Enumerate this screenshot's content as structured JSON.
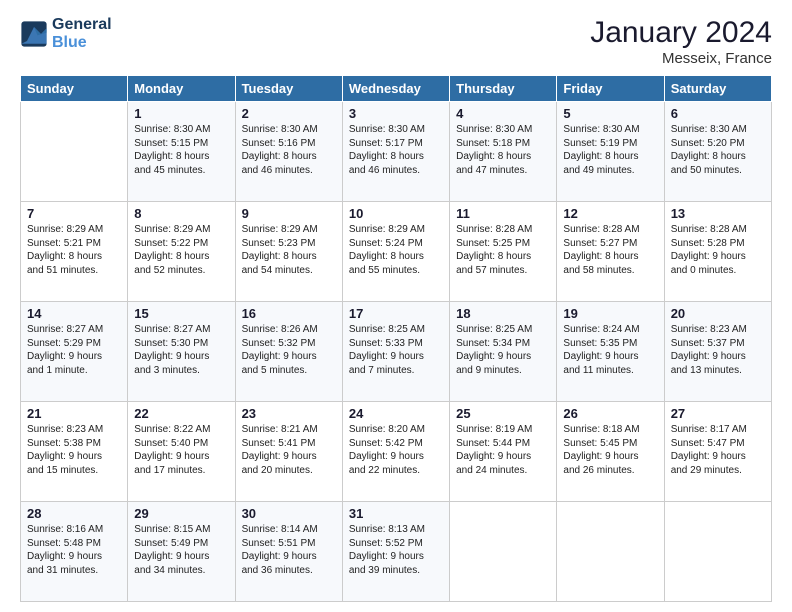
{
  "header": {
    "logo_line1": "General",
    "logo_line2": "Blue",
    "month": "January 2024",
    "location": "Messeix, France"
  },
  "weekdays": [
    "Sunday",
    "Monday",
    "Tuesday",
    "Wednesday",
    "Thursday",
    "Friday",
    "Saturday"
  ],
  "weeks": [
    [
      {
        "day": "",
        "sunrise": "",
        "sunset": "",
        "daylight": ""
      },
      {
        "day": "1",
        "sunrise": "Sunrise: 8:30 AM",
        "sunset": "Sunset: 5:15 PM",
        "daylight": "Daylight: 8 hours and 45 minutes."
      },
      {
        "day": "2",
        "sunrise": "Sunrise: 8:30 AM",
        "sunset": "Sunset: 5:16 PM",
        "daylight": "Daylight: 8 hours and 46 minutes."
      },
      {
        "day": "3",
        "sunrise": "Sunrise: 8:30 AM",
        "sunset": "Sunset: 5:17 PM",
        "daylight": "Daylight: 8 hours and 46 minutes."
      },
      {
        "day": "4",
        "sunrise": "Sunrise: 8:30 AM",
        "sunset": "Sunset: 5:18 PM",
        "daylight": "Daylight: 8 hours and 47 minutes."
      },
      {
        "day": "5",
        "sunrise": "Sunrise: 8:30 AM",
        "sunset": "Sunset: 5:19 PM",
        "daylight": "Daylight: 8 hours and 49 minutes."
      },
      {
        "day": "6",
        "sunrise": "Sunrise: 8:30 AM",
        "sunset": "Sunset: 5:20 PM",
        "daylight": "Daylight: 8 hours and 50 minutes."
      }
    ],
    [
      {
        "day": "7",
        "sunrise": "Sunrise: 8:29 AM",
        "sunset": "Sunset: 5:21 PM",
        "daylight": "Daylight: 8 hours and 51 minutes."
      },
      {
        "day": "8",
        "sunrise": "Sunrise: 8:29 AM",
        "sunset": "Sunset: 5:22 PM",
        "daylight": "Daylight: 8 hours and 52 minutes."
      },
      {
        "day": "9",
        "sunrise": "Sunrise: 8:29 AM",
        "sunset": "Sunset: 5:23 PM",
        "daylight": "Daylight: 8 hours and 54 minutes."
      },
      {
        "day": "10",
        "sunrise": "Sunrise: 8:29 AM",
        "sunset": "Sunset: 5:24 PM",
        "daylight": "Daylight: 8 hours and 55 minutes."
      },
      {
        "day": "11",
        "sunrise": "Sunrise: 8:28 AM",
        "sunset": "Sunset: 5:25 PM",
        "daylight": "Daylight: 8 hours and 57 minutes."
      },
      {
        "day": "12",
        "sunrise": "Sunrise: 8:28 AM",
        "sunset": "Sunset: 5:27 PM",
        "daylight": "Daylight: 8 hours and 58 minutes."
      },
      {
        "day": "13",
        "sunrise": "Sunrise: 8:28 AM",
        "sunset": "Sunset: 5:28 PM",
        "daylight": "Daylight: 9 hours and 0 minutes."
      }
    ],
    [
      {
        "day": "14",
        "sunrise": "Sunrise: 8:27 AM",
        "sunset": "Sunset: 5:29 PM",
        "daylight": "Daylight: 9 hours and 1 minute."
      },
      {
        "day": "15",
        "sunrise": "Sunrise: 8:27 AM",
        "sunset": "Sunset: 5:30 PM",
        "daylight": "Daylight: 9 hours and 3 minutes."
      },
      {
        "day": "16",
        "sunrise": "Sunrise: 8:26 AM",
        "sunset": "Sunset: 5:32 PM",
        "daylight": "Daylight: 9 hours and 5 minutes."
      },
      {
        "day": "17",
        "sunrise": "Sunrise: 8:25 AM",
        "sunset": "Sunset: 5:33 PM",
        "daylight": "Daylight: 9 hours and 7 minutes."
      },
      {
        "day": "18",
        "sunrise": "Sunrise: 8:25 AM",
        "sunset": "Sunset: 5:34 PM",
        "daylight": "Daylight: 9 hours and 9 minutes."
      },
      {
        "day": "19",
        "sunrise": "Sunrise: 8:24 AM",
        "sunset": "Sunset: 5:35 PM",
        "daylight": "Daylight: 9 hours and 11 minutes."
      },
      {
        "day": "20",
        "sunrise": "Sunrise: 8:23 AM",
        "sunset": "Sunset: 5:37 PM",
        "daylight": "Daylight: 9 hours and 13 minutes."
      }
    ],
    [
      {
        "day": "21",
        "sunrise": "Sunrise: 8:23 AM",
        "sunset": "Sunset: 5:38 PM",
        "daylight": "Daylight: 9 hours and 15 minutes."
      },
      {
        "day": "22",
        "sunrise": "Sunrise: 8:22 AM",
        "sunset": "Sunset: 5:40 PM",
        "daylight": "Daylight: 9 hours and 17 minutes."
      },
      {
        "day": "23",
        "sunrise": "Sunrise: 8:21 AM",
        "sunset": "Sunset: 5:41 PM",
        "daylight": "Daylight: 9 hours and 20 minutes."
      },
      {
        "day": "24",
        "sunrise": "Sunrise: 8:20 AM",
        "sunset": "Sunset: 5:42 PM",
        "daylight": "Daylight: 9 hours and 22 minutes."
      },
      {
        "day": "25",
        "sunrise": "Sunrise: 8:19 AM",
        "sunset": "Sunset: 5:44 PM",
        "daylight": "Daylight: 9 hours and 24 minutes."
      },
      {
        "day": "26",
        "sunrise": "Sunrise: 8:18 AM",
        "sunset": "Sunset: 5:45 PM",
        "daylight": "Daylight: 9 hours and 26 minutes."
      },
      {
        "day": "27",
        "sunrise": "Sunrise: 8:17 AM",
        "sunset": "Sunset: 5:47 PM",
        "daylight": "Daylight: 9 hours and 29 minutes."
      }
    ],
    [
      {
        "day": "28",
        "sunrise": "Sunrise: 8:16 AM",
        "sunset": "Sunset: 5:48 PM",
        "daylight": "Daylight: 9 hours and 31 minutes."
      },
      {
        "day": "29",
        "sunrise": "Sunrise: 8:15 AM",
        "sunset": "Sunset: 5:49 PM",
        "daylight": "Daylight: 9 hours and 34 minutes."
      },
      {
        "day": "30",
        "sunrise": "Sunrise: 8:14 AM",
        "sunset": "Sunset: 5:51 PM",
        "daylight": "Daylight: 9 hours and 36 minutes."
      },
      {
        "day": "31",
        "sunrise": "Sunrise: 8:13 AM",
        "sunset": "Sunset: 5:52 PM",
        "daylight": "Daylight: 9 hours and 39 minutes."
      },
      {
        "day": "",
        "sunrise": "",
        "sunset": "",
        "daylight": ""
      },
      {
        "day": "",
        "sunrise": "",
        "sunset": "",
        "daylight": ""
      },
      {
        "day": "",
        "sunrise": "",
        "sunset": "",
        "daylight": ""
      }
    ]
  ]
}
